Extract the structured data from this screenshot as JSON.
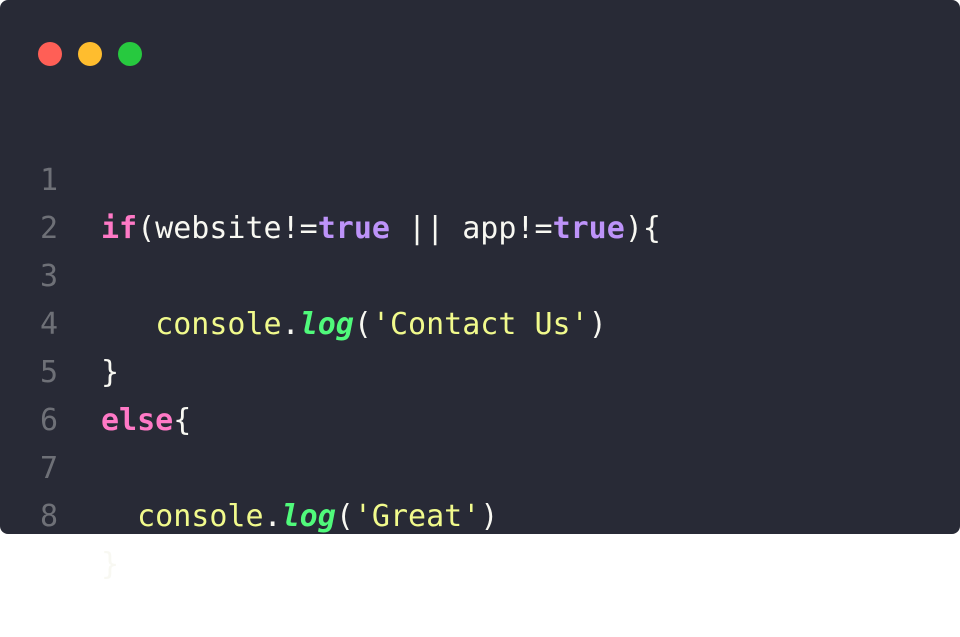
{
  "window": {
    "colors": {
      "background": "#282a36",
      "close": "#ff5f56",
      "minimize": "#ffbd2e",
      "maximize": "#27c93f"
    }
  },
  "code": {
    "lines": [
      {
        "num": "1",
        "t": {
          "a": "if",
          "b": "(website!=",
          "c": "true",
          "d": " || app!=",
          "e": "true",
          "f": "){"
        }
      },
      {
        "num": "2"
      },
      {
        "num": "3",
        "t": {
          "indent": "   ",
          "obj": "console",
          "dot": ".",
          "fn": "log",
          "p1": "(",
          "str": "'Contact Us'",
          "p2": ")"
        }
      },
      {
        "num": "4",
        "t": {
          "a": "}"
        }
      },
      {
        "num": "5",
        "t": {
          "kw": "else",
          "a": "{"
        }
      },
      {
        "num": "6"
      },
      {
        "num": "7",
        "t": {
          "indent": "  ",
          "obj": "console",
          "dot": ".",
          "fn": "log",
          "p1": "(",
          "str": "'Great'",
          "p2": ")"
        }
      },
      {
        "num": "8",
        "t": {
          "a": "}"
        }
      }
    ]
  }
}
